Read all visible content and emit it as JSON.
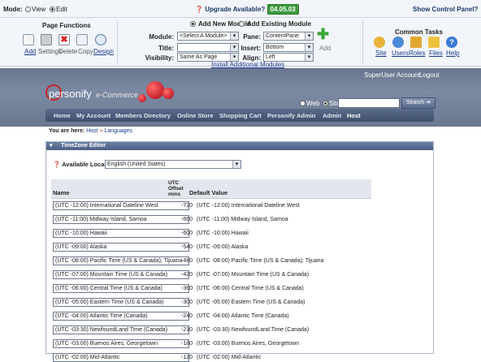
{
  "control_panel": {
    "mode_label": "Mode:",
    "view": "View",
    "edit": "Edit",
    "upgrade": "Upgrade Available?",
    "version": "04.05.03",
    "show_cp": "Show Control Panel?",
    "page_functions_title": "Page Functions",
    "page_functions": [
      "Add",
      "Settings",
      "Delete",
      "Copy",
      "Design"
    ],
    "add_new_module": "Add New Module",
    "add_existing_module": "Add Existing Module",
    "module_label": "Module:",
    "module_value": "<Select A Module>",
    "pane_label": "Pane:",
    "pane_value": "ContentPane",
    "title_label": "Title:",
    "insert_label": "Insert:",
    "insert_value": "Bottom",
    "visibility_label": "Visibility:",
    "visibility_value": "Same As Page",
    "align_label": "Align:",
    "align_value": "Left",
    "add_label": "Add",
    "install_link": "Install Additional Modules",
    "common_tasks_title": "Common Tasks",
    "common_tasks": [
      "Site",
      "Users",
      "Roles",
      "Files",
      "Help"
    ]
  },
  "site": {
    "logo": "personify",
    "logo_sub": "e-Commerce",
    "superuser": "SuperUser Account",
    "logout": "Logout",
    "web": "Web",
    "site": "Site",
    "search_btn": "Search ➔",
    "nav": [
      "Home",
      "My Account",
      "Members Directory",
      "Online Store",
      "Shopping Cart",
      "Personify Admin",
      "Admin",
      "Host"
    ],
    "breadcrumb_prefix": "You are here:",
    "breadcrumb_host": "Host",
    "breadcrumb_sep": "»",
    "breadcrumb_page": "Languages"
  },
  "editor": {
    "title": "TimeZone Editor",
    "locales_label": "Available Locales",
    "locale_value": "English (United States)",
    "col_name": "Name",
    "col_offset": "UTC Offset mins",
    "col_default": "Default Value",
    "rows": [
      {
        "name": "(UTC -12:00) International Dateline West",
        "offset": "-720",
        "default": "(UTC -12:00) International Dateline West"
      },
      {
        "name": "(UTC -11:00) Midway Island, Samoa",
        "offset": "-660",
        "default": "(UTC -11:00) Midway Island, Samoa"
      },
      {
        "name": "(UTC -10:00) Hawaii",
        "offset": "-600",
        "default": "(UTC -10:00) Hawaii"
      },
      {
        "name": "(UTC -09:00) Alaska",
        "offset": "-540",
        "default": "(UTC -09:00) Alaska"
      },
      {
        "name": "(UTC -08:00) Pacific Time (US & Canada); Tijuana",
        "offset": "-480",
        "default": "(UTC -08:00) Pacific Time (US & Canada); Tijuana"
      },
      {
        "name": "(UTC -07:00) Mountain Time (US & Canada)",
        "offset": "-420",
        "default": "(UTC -07:00) Mountain Time (US & Canada)"
      },
      {
        "name": "(UTC -06:00) Central Time (US & Canada)",
        "offset": "-360",
        "default": "(UTC -06:00) Central Time (US & Canada)"
      },
      {
        "name": "(UTC -05:00) Eastern Time (US & Canada)",
        "offset": "-300",
        "default": "(UTC -05:00) Eastern Time (US & Canada)"
      },
      {
        "name": "(UTC -04:00) Atlantic Time (Canada)",
        "offset": "-240",
        "default": "(UTC -04:00) Atlantic Time (Canada)"
      },
      {
        "name": "(UTC -03:30) NewfoundLand Time (Canada)",
        "offset": "-210",
        "default": "(UTC -03:30) NewfoundLand Time (Canada)"
      },
      {
        "name": "(UTC -03:00) Buenos Aires, Georgetown",
        "offset": "-180",
        "default": "(UTC -03:00) Buenos Aires, Georgetown"
      },
      {
        "name": "(UTC -02:00) Mid-Atlantic",
        "offset": "-120",
        "default": "(UTC -02:00) Mid-Atlantic"
      }
    ]
  }
}
